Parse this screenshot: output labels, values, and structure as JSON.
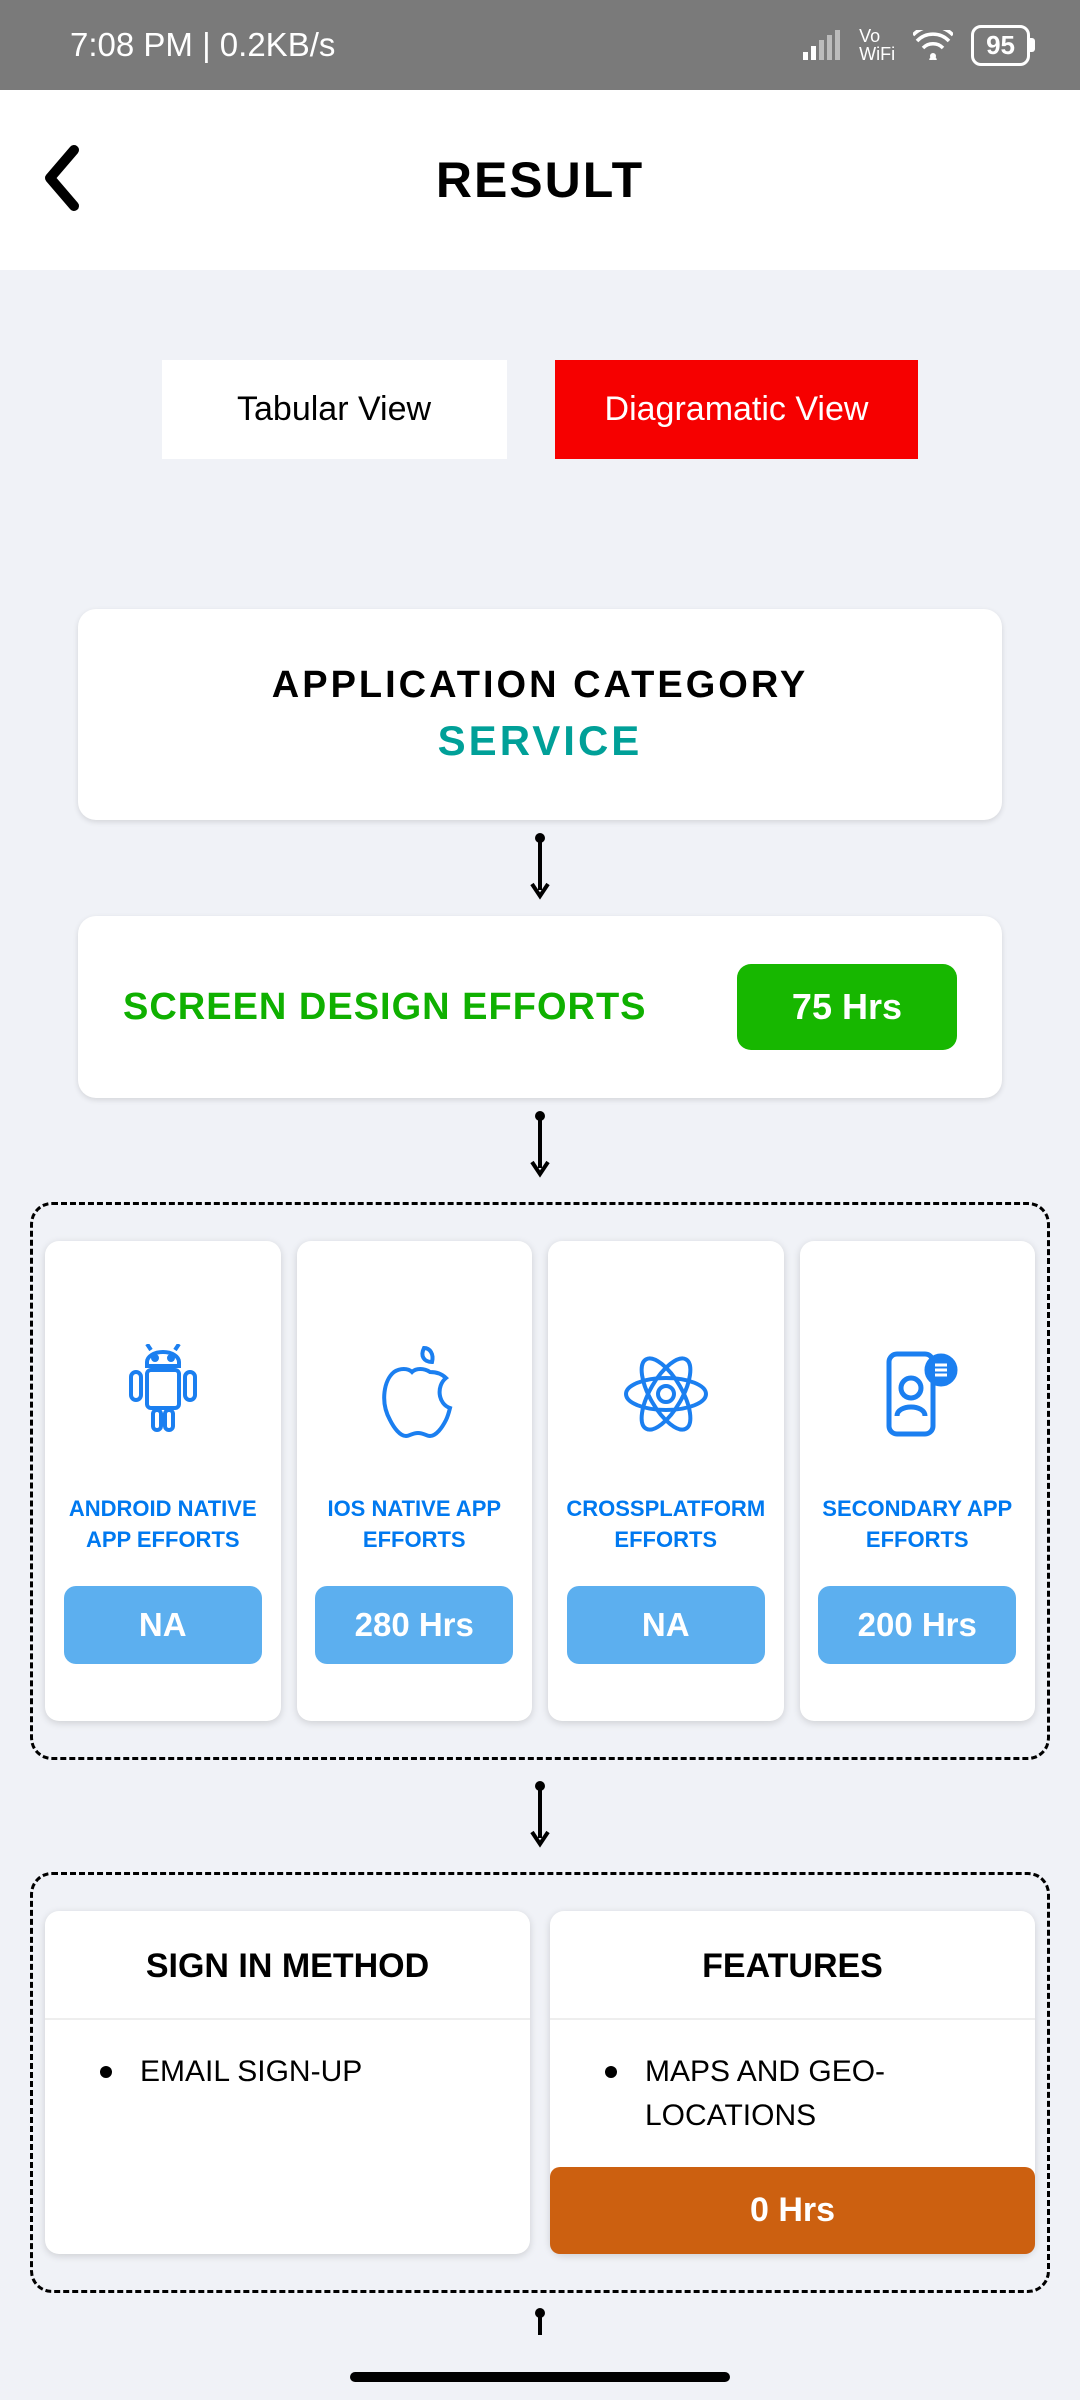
{
  "status_bar": {
    "time": "7:08 PM | 0.2KB/s",
    "vo_label": "Vo",
    "wifi_label": "WiFi",
    "battery": "95"
  },
  "header": {
    "title": "RESULT"
  },
  "tabs": {
    "tabular": "Tabular View",
    "diagramatic": "Diagramatic View"
  },
  "category": {
    "label": "APPLICATION CATEGORY",
    "value": "SERVICE"
  },
  "effort": {
    "label": "SCREEN DESIGN EFFORTS",
    "badge": "75 Hrs"
  },
  "platforms": [
    {
      "label": "ANDROID NATIVE APP EFFORTS",
      "badge": "NA"
    },
    {
      "label": "IOS NATIVE APP EFFORTS",
      "badge": "280 Hrs"
    },
    {
      "label": "CROSSPLATFORM EFFORTS",
      "badge": "NA"
    },
    {
      "label": "SECONDARY APP EFFORTS",
      "badge": "200 Hrs"
    }
  ],
  "signin": {
    "title": "SIGN IN METHOD",
    "item": "EMAIL SIGN-UP"
  },
  "features": {
    "title": "FEATURES",
    "item": "MAPS AND GEO-LOCATIONS",
    "badge": "0 Hrs"
  }
}
